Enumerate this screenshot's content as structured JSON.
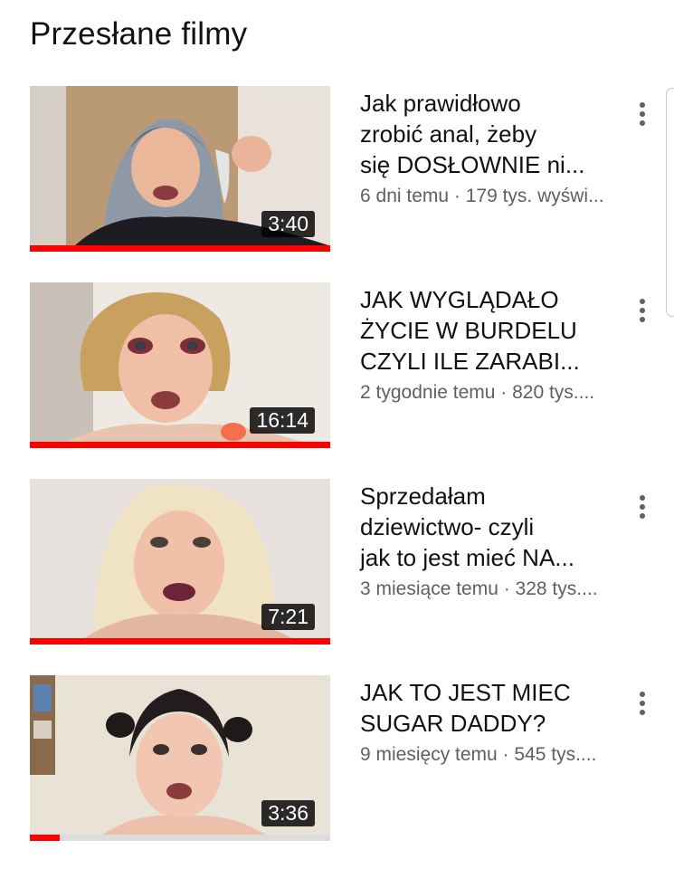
{
  "section": {
    "title": "Przesłane filmy"
  },
  "videos": [
    {
      "title_lines": [
        "Jak prawidłowo",
        "zrobić anal, żeby",
        "się DOSŁOWNIE ni..."
      ],
      "stats": "6 dni temu · 179 tys. wyświ...",
      "duration": "3:40",
      "watch_progress": 1.0
    },
    {
      "title_lines": [
        "JAK WYGLĄDAŁO",
        "ŻYCIE W BURDELU",
        "CZYLI ILE ZARABI..."
      ],
      "stats": "2 tygodnie temu · 820 tys....",
      "duration": "16:14",
      "watch_progress": 1.0
    },
    {
      "title_lines": [
        "Sprzedałam",
        "dziewictwo- czyli",
        "jak to jest mieć NA..."
      ],
      "stats": "3 miesiące temu · 328 tys....",
      "duration": "7:21",
      "watch_progress": 1.0
    },
    {
      "title_lines": [
        "JAK TO JEST MIEC",
        "SUGAR DADDY?"
      ],
      "stats": "9 miesięcy temu · 545 tys....",
      "duration": "3:36",
      "watch_progress": 0.1
    }
  ],
  "colors": {
    "progress": "#ff0000",
    "progress_track": "#dcdcdc",
    "secondary_text": "#606060"
  },
  "icons": {
    "more": "more-vert-icon"
  }
}
